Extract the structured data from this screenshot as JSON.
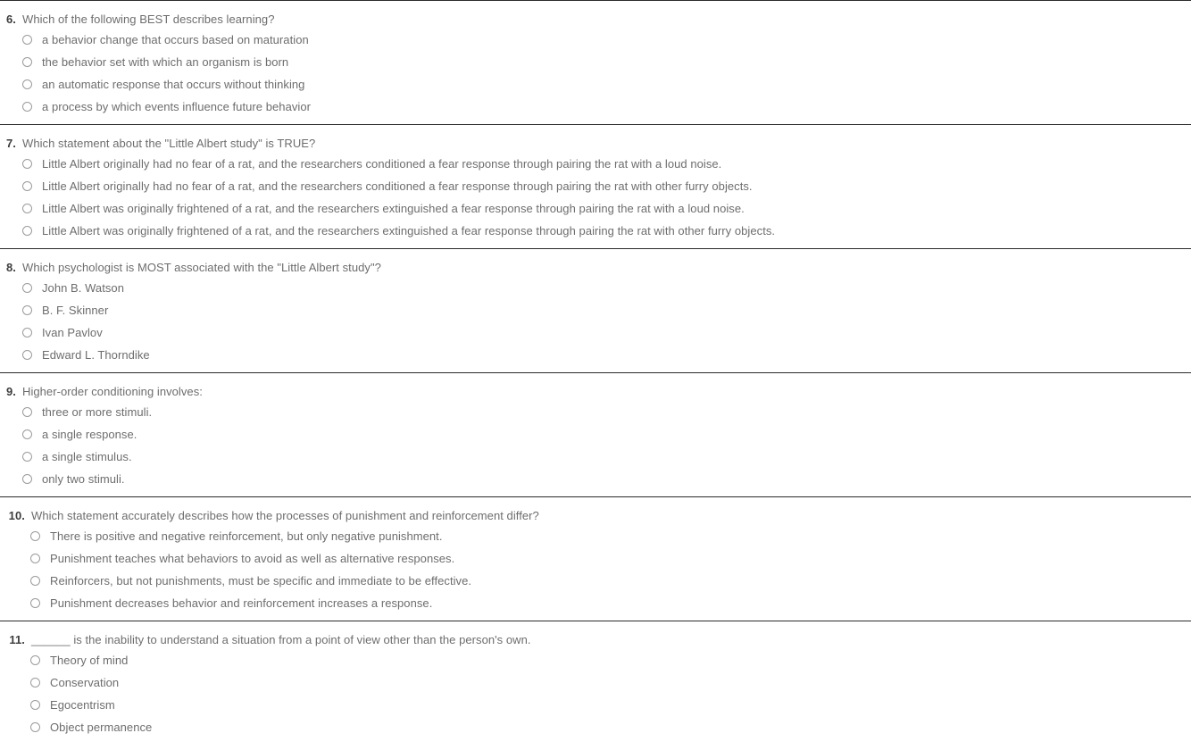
{
  "theme": {
    "page_background": "#ffffff",
    "divider_color": "#2b2b2b",
    "question_number_color": "#3d3d3d",
    "body_text_color": "#6d6d6d",
    "radio_border_color": "#9b9b9b"
  },
  "quiz": {
    "questions": [
      {
        "number": "6.",
        "text": "Which of the following BEST describes learning?",
        "options": [
          "a behavior change that occurs based on maturation",
          "the behavior set with which an organism is born",
          "an automatic response that occurs without thinking",
          "a process by which events influence future behavior"
        ]
      },
      {
        "number": "7.",
        "text": "Which statement about the \"Little Albert study\" is TRUE?",
        "options": [
          "Little Albert originally had no fear of a rat, and the researchers conditioned a fear response through pairing the rat with a loud noise.",
          "Little Albert originally had no fear of a rat, and the researchers conditioned a fear response through pairing the rat with other furry objects.",
          "Little Albert was originally frightened of a rat, and the researchers extinguished a fear response through pairing the rat with a loud noise.",
          "Little Albert was originally frightened of a rat, and the researchers extinguished a fear response through pairing the rat with other furry objects."
        ]
      },
      {
        "number": "8.",
        "text": "Which psychologist is MOST associated with the \"Little Albert study\"?",
        "options": [
          "John B. Watson",
          "B. F. Skinner",
          "Ivan Pavlov",
          "Edward L. Thorndike"
        ]
      },
      {
        "number": "9.",
        "text": "Higher-order conditioning involves:",
        "options": [
          "three or more stimuli.",
          "a single response.",
          "a single stimulus.",
          "only two stimuli."
        ]
      },
      {
        "number": "10.",
        "text": "Which statement accurately describes how the processes of punishment and reinforcement differ?",
        "options": [
          "There is positive and negative reinforcement, but only negative punishment.",
          "Punishment teaches what behaviors to avoid as well as alternative responses.",
          "Reinforcers, but not punishments, must be specific and immediate to be effective.",
          "Punishment decreases behavior and reinforcement increases a response."
        ]
      },
      {
        "number": "11.",
        "text": "______ is the inability to understand a situation from a point of view other than the person's own.",
        "options": [
          "Theory of mind",
          "Conservation",
          "Egocentrism",
          "Object permanence"
        ]
      }
    ]
  }
}
